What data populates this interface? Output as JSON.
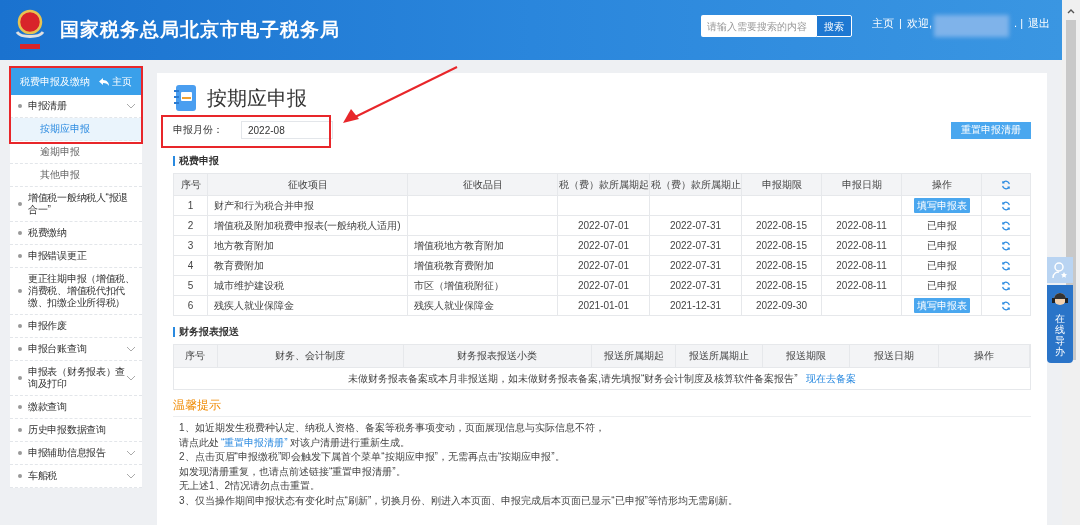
{
  "header": {
    "title": "国家税务总局北京市电子税务局",
    "search": {
      "placeholder": "请输入需要搜索的内容",
      "button": "搜索"
    },
    "links": [
      {
        "kind": "link",
        "label": "主页"
      },
      {
        "kind": "sep",
        "label": "|"
      },
      {
        "kind": "user",
        "label": "欢迎,"
      },
      {
        "kind": "sep",
        "label": ". |"
      },
      {
        "kind": "link",
        "label": "退出"
      }
    ]
  },
  "sidebar": {
    "title": "税费申报及缴纳",
    "home": "主页",
    "items": [
      {
        "label": "申报清册",
        "kind": "group",
        "expanded": true,
        "children": [
          {
            "label": "按期应申报",
            "selected": true
          },
          {
            "label": "逾期申报",
            "selected": false
          },
          {
            "label": "其他申报",
            "selected": false
          }
        ]
      },
      {
        "label": "增值税一般纳税人“报退合一”"
      },
      {
        "label": "税费缴纳"
      },
      {
        "label": "申报错误更正"
      },
      {
        "label": "更正往期申报（增值税、消费税、增值税代扣代缴、扣缴企业所得税）"
      },
      {
        "label": "申报作废"
      },
      {
        "label": "申报台账查询",
        "kind": "group"
      },
      {
        "label": "申报表（财务报表）查询及打印",
        "kind": "group"
      },
      {
        "label": "缴款查询"
      },
      {
        "label": "历史申报数据查询"
      },
      {
        "label": "申报辅助信息报告",
        "kind": "group"
      },
      {
        "label": "车船税",
        "kind": "group"
      }
    ]
  },
  "page": {
    "title": "按期应申报",
    "month_label": "申报月份：",
    "month_value": "2022-08",
    "reset_button": "重置申报清册"
  },
  "tax_section": {
    "title": "税费申报",
    "columns": [
      "序号",
      "征收项目",
      "征收品目",
      "税（费）款所属期起",
      "税（费）款所属期止",
      "申报期限",
      "申报日期",
      "操作"
    ],
    "rows": [
      {
        "cells": [
          "1",
          "财产和行为税合并申报",
          "",
          "",
          "",
          "",
          ""
        ],
        "action": {
          "kind": "button",
          "label": "填写申报表"
        }
      },
      {
        "cells": [
          "2",
          "增值税及附加税费申报表(一般纳税人适用)",
          "",
          "2022-07-01",
          "2022-07-31",
          "2022-08-15",
          "2022-08-11"
        ],
        "action": {
          "kind": "text",
          "label": "已申报"
        }
      },
      {
        "cells": [
          "3",
          "地方教育附加",
          "增值税地方教育附加",
          "2022-07-01",
          "2022-07-31",
          "2022-08-15",
          "2022-08-11"
        ],
        "action": {
          "kind": "text",
          "label": "已申报"
        }
      },
      {
        "cells": [
          "4",
          "教育费附加",
          "增值税教育费附加",
          "2022-07-01",
          "2022-07-31",
          "2022-08-15",
          "2022-08-11"
        ],
        "action": {
          "kind": "text",
          "label": "已申报"
        }
      },
      {
        "cells": [
          "5",
          "城市维护建设税",
          "市区（增值税附征）",
          "2022-07-01",
          "2022-07-31",
          "2022-08-15",
          "2022-08-11"
        ],
        "action": {
          "kind": "text",
          "label": "已申报"
        }
      },
      {
        "cells": [
          "6",
          "残疾人就业保障金",
          "残疾人就业保障金",
          "2021-01-01",
          "2021-12-31",
          "2022-09-30",
          ""
        ],
        "action": {
          "kind": "button",
          "label": "填写申报表"
        }
      }
    ]
  },
  "finance_section": {
    "title": "财务报表报送",
    "columns": [
      "序号",
      "财务、会计制度",
      "财务报表报送小类",
      "报送所属期起",
      "报送所属期止",
      "报送期限",
      "报送日期",
      "操作"
    ],
    "message": "未做财务报表备案或本月非报送期，如未做财务报表备案,请先填报“财务会计制度及核算软件备案报告”",
    "message_link": "现在去备案"
  },
  "tips": {
    "title": "温馨提示",
    "lines": [
      {
        "text": "1、如近期发生税费种认定、纳税人资格、备案等税务事项变动，页面展现信息与实际信息不符，"
      },
      {
        "text": "请点此处",
        "link": "“重置申报清册”",
        "after": "对该户清册进行重新生成。"
      },
      {
        "text": "2、点击页眉“申报缴税”即会触发下属首个菜单“按期应申报”，无需再点击“按期应申报”。"
      },
      {
        "text": "如发现清册重复，也请点前述链接“重置申报清册”。"
      },
      {
        "text": "无上述1、2情况请勿点击重置。"
      },
      {
        "text": "3、仅当操作期间申报状态有变化时点“刷新”，切换月份、刚进入本页面、申报完成后本页面已显示“已申报”等情形均无需刷新。"
      }
    ]
  },
  "guide": {
    "label": "在线导办"
  }
}
